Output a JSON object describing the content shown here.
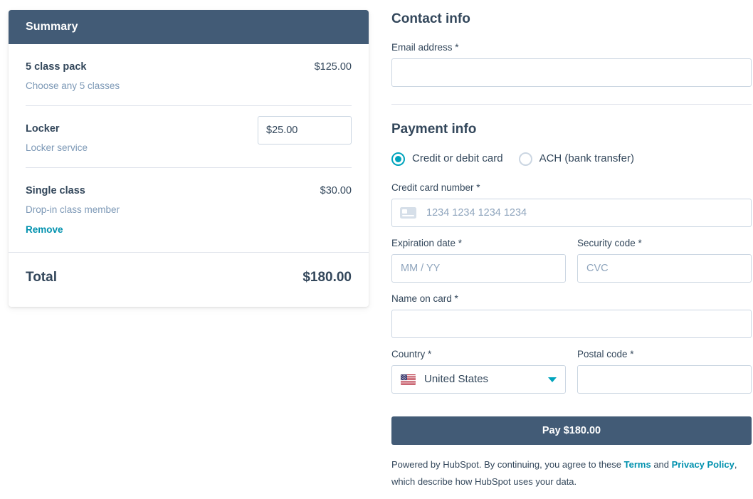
{
  "summary": {
    "header_title": "Summary",
    "items": [
      {
        "name": "5 class pack",
        "description": "Choose any 5 classes",
        "price": "$125.00",
        "input_value": null,
        "remove_label": null
      },
      {
        "name": "Locker",
        "description": "Locker service",
        "price": null,
        "input_value": "$25.00",
        "remove_label": null
      },
      {
        "name": "Single class",
        "description": "Drop-in class member",
        "price": "$30.00",
        "input_value": null,
        "remove_label": "Remove"
      }
    ],
    "total_label": "Total",
    "total_value": "$180.00"
  },
  "contact": {
    "section_title": "Contact info",
    "email_label": "Email address *",
    "email_value": "",
    "email_placeholder": ""
  },
  "payment": {
    "section_title": "Payment info",
    "methods": [
      {
        "label": "Credit or debit card",
        "selected": true
      },
      {
        "label": "ACH (bank transfer)",
        "selected": false
      }
    ],
    "card_number_label": "Credit card number *",
    "card_number_placeholder": "1234 1234 1234 1234",
    "card_number_value": "",
    "expiration_label": "Expiration date *",
    "expiration_placeholder": "MM / YY",
    "expiration_value": "",
    "security_label": "Security code *",
    "security_placeholder": "CVC",
    "security_value": "",
    "name_label": "Name on card *",
    "name_value": "",
    "name_placeholder": "",
    "country_label": "Country *",
    "country_value": "United States",
    "country_flag": "us-flag-icon",
    "postal_label": "Postal code *",
    "postal_value": "",
    "postal_placeholder": "",
    "pay_button_label": "Pay $180.00"
  },
  "footer": {
    "text_before": "Powered by HubSpot. By continuing, you agree to these ",
    "terms_link": "Terms",
    "text_middle": " and ",
    "privacy_link": "Privacy Policy",
    "text_after": ", which describe how HubSpot uses your data."
  },
  "colors": {
    "brand_dark": "#425b76",
    "accent_teal": "#00a4bd",
    "link_teal": "#0091ae",
    "text": "#33475b",
    "muted": "#7c98b6",
    "border": "#cbd6e2"
  }
}
